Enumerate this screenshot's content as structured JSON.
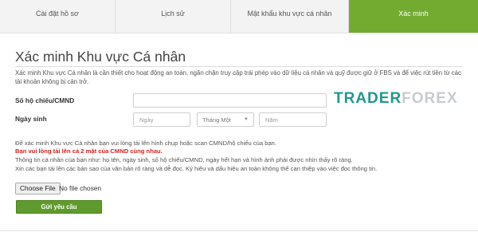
{
  "tabs": [
    {
      "label": "Cài đặt hồ sơ",
      "icon": "profile-icon"
    },
    {
      "label": "Lịch sử",
      "icon": "history-icon"
    },
    {
      "label": "Mật khẩu khu vực cá nhân",
      "icon": "password-icon"
    },
    {
      "label": "Xác minh",
      "icon": "verify-icon",
      "active": true
    }
  ],
  "page": {
    "title": "Xác minh Khu vực Cá nhân",
    "intro": "Xác minh Khu vực Cá nhân là cần thiết cho hoạt động an toàn, ngăn chặn truy cập trái phép vào dữ liệu cá nhân và quỹ được giữ ở FBS và để việc rút tiền từ các tài khoản không bị cản trở."
  },
  "form": {
    "passport_label": "Số hộ chiếu/CMND",
    "passport_value": "",
    "dob_label": "Ngày sinh",
    "day_placeholder": "Ngày",
    "month_value": "Tháng Một",
    "year_placeholder": "Năm"
  },
  "watermark": {
    "part1": "TRADER",
    "part2": "FOREX"
  },
  "notes": {
    "line1": "Để xác minh Khu vực Cá nhân bạn vui lòng tải lên hình chụp hoặc scan CMND/hộ chiếu của bạn.",
    "warning": "Bạn vui lòng tải lên cả 2 mặt của CMND cùng nhau.",
    "line3": "Thông tin cá nhân của bạn như: họ tên, ngày sinh, số hộ chiếu/CMND, ngày hết hạn và hình ảnh phải được nhìn thấy rõ ràng.",
    "line4": "Xin các bạn tải lên các bản sao của văn bản rõ ràng và dễ đọc. Ký hiệu và dấu hiệu an toàn không thể can thiệp vào việc đọc thông tin."
  },
  "upload": {
    "button_label": "Choose File",
    "status": "No file chosen"
  },
  "submit_label": "Gửi yêu cầu",
  "colors": {
    "accent": "#72ab2f",
    "button": "#5f9a2c",
    "warning": "#d21f1f",
    "watermark_a": "#1d9a8c",
    "watermark_b": "#c8ccd0"
  }
}
